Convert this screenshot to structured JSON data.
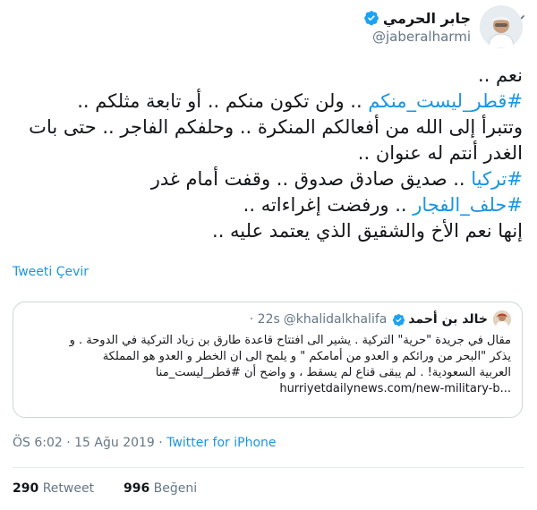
{
  "tweet": {
    "author_name": "جابر الحرمي",
    "author_handle": "@jaberalharmi",
    "lines": [
      {
        "text": "نعم ..",
        "hashtag": ""
      },
      {
        "hashtag": "#قطر_ليست_منكم",
        "text": " .. ولن تكون منكم .. أو تابعة مثلكم .."
      },
      {
        "text": "وتتبرأ إلى الله من أفعالكم المنكرة .. وحلفكم الفاجر .. حتى بات",
        "hashtag": ""
      },
      {
        "text": "الغدر أنتم له عنوان ..",
        "hashtag": ""
      },
      {
        "hashtag": "#تركيا",
        "text": " .. صديق صادق صدوق .. وقفت أمام غدر"
      },
      {
        "hashtag": "#حلف_الفجار",
        "text": " .. ورفضت إغراءاته .."
      },
      {
        "text": "إنها نعم الأخ والشقيق الذي يعتمد عليه ..",
        "hashtag": ""
      }
    ],
    "translate_label": "Tweeti Çevir",
    "timestamp": "ÖS 6:02 · 15 Ağu 2019 · ",
    "client": "Twitter for iPhone",
    "retweets": "290",
    "retweets_label": "Retweet",
    "likes": "996",
    "likes_label": "Beğeni"
  },
  "quoted": {
    "name": "خالد بن أحمد",
    "handle": "@khalidalkhalifa",
    "time": "· 22s",
    "lines": [
      "مقال في جريدة \"حرية\" التركية . يشير الى افتتاح قاعدة طارق بن زياد التركية في الدوحة . و",
      "يذكر \"البحر من ورائكم و العدو من أمامكم \" و يلمح الى ان الخطر و العدو هو المملكة",
      "العربية السعودية! . لم يبقى قناع لم يسقط ، و واضح أن #قطر_ليست_منا"
    ],
    "url": "hurriyetdailynews.com/new-military-b..."
  },
  "colors": {
    "link": "#1b95e0",
    "verified": "#1da1f2",
    "muted": "#657786",
    "border": "#ccd6dd"
  },
  "icons": [
    "chevron-down-icon",
    "verified-badge-icon"
  ]
}
